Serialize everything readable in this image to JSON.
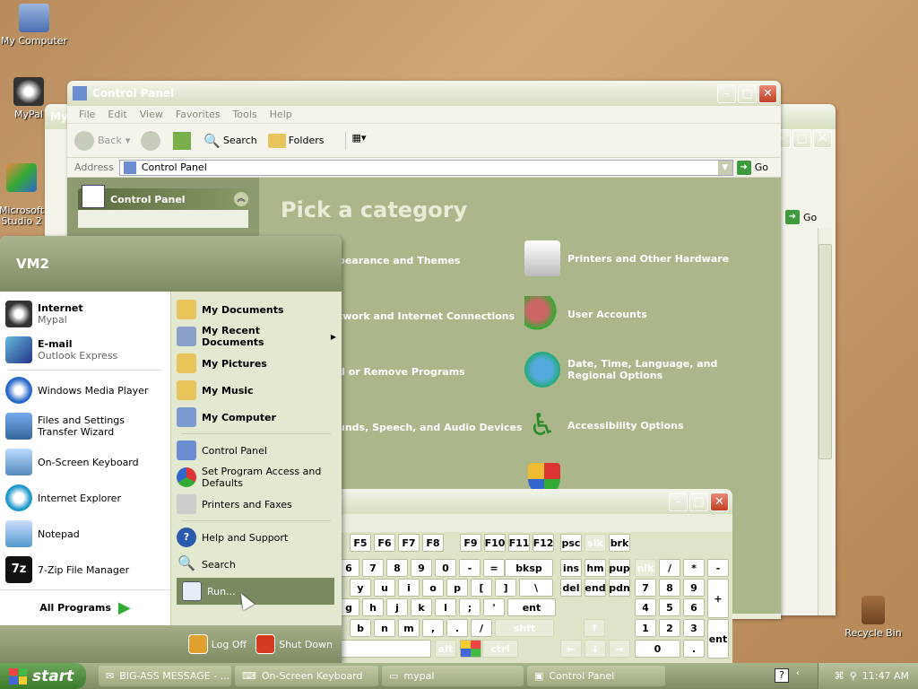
{
  "desktop": {
    "icons": [
      {
        "label": "My Computer"
      },
      {
        "label": "MyPal"
      },
      {
        "label": "Microsoft\nStudio 2"
      },
      {
        "label": "Recycle Bin"
      }
    ]
  },
  "back_window": {
    "title": "My",
    "address_fragment": "Go",
    "go_label": "Go"
  },
  "control_panel": {
    "title": "Control Panel",
    "menu": [
      "File",
      "Edit",
      "View",
      "Favorites",
      "Tools",
      "Help"
    ],
    "toolbar": {
      "back": "Back",
      "search": "Search",
      "folders": "Folders"
    },
    "address_label": "Address",
    "address_value": "Control Panel",
    "go_label": "Go",
    "sidebar_title": "Control Panel",
    "heading": "Pick a category",
    "categories_left": [
      "pearance and Themes",
      "twork and Internet Connections",
      "d or Remove Programs",
      "unds, Speech, and Audio Devices"
    ],
    "categories_right": [
      "Printers and Other Hardware",
      "User Accounts",
      "Date, Time, Language, and Regional Options",
      "Accessibility Options"
    ]
  },
  "start_menu": {
    "user": "VM2",
    "pinned": [
      {
        "title": "Internet",
        "sub": "Mypal"
      },
      {
        "title": "E-mail",
        "sub": "Outlook Express"
      }
    ],
    "recent": [
      "Windows Media Player",
      "Files and Settings Transfer Wizard",
      "On-Screen Keyboard",
      "Internet Explorer",
      "Notepad",
      "7-Zip File Manager"
    ],
    "all_programs": "All Programs",
    "right_items": [
      "My Documents",
      "My Recent Documents",
      "My Pictures",
      "My Music",
      "My Computer",
      "Control Panel",
      "Set Program Access and Defaults",
      "Printers and Faxes",
      "Help and Support",
      "Search",
      "Run..."
    ],
    "log_off": "Log Off",
    "shut_down": "Shut Down"
  },
  "osk": {
    "row_f": [
      "F5",
      "F6",
      "F7",
      "F8",
      "F9",
      "F10",
      "F11",
      "F12",
      "psc",
      "slk",
      "brk"
    ],
    "row_num": [
      "6",
      "7",
      "8",
      "9",
      "0",
      "-",
      "=",
      "bksp",
      "ins",
      "hm",
      "pup",
      "nlk",
      "/",
      "*",
      "-"
    ],
    "row_top": [
      "y",
      "u",
      "i",
      "o",
      "p",
      "[",
      "]",
      "\\",
      "del",
      "end",
      "pdn",
      "7",
      "8",
      "9",
      "+"
    ],
    "row_mid": [
      "g",
      "h",
      "j",
      "k",
      "l",
      ";",
      "'",
      "ent",
      "4",
      "5",
      "6"
    ],
    "row_bot": [
      "b",
      "n",
      "m",
      ",",
      ".",
      "/",
      "shft",
      "↑",
      "1",
      "2",
      "3",
      "ent"
    ],
    "row_sp": [
      "alt",
      "ctrl",
      "←",
      "↓",
      "→",
      "0",
      "."
    ]
  },
  "taskbar": {
    "start": "start",
    "tasks": [
      "BIG-ASS MESSAGE - ...",
      "On-Screen Keyboard",
      "mypal",
      "Control Panel"
    ],
    "clock": "11:47 AM"
  }
}
